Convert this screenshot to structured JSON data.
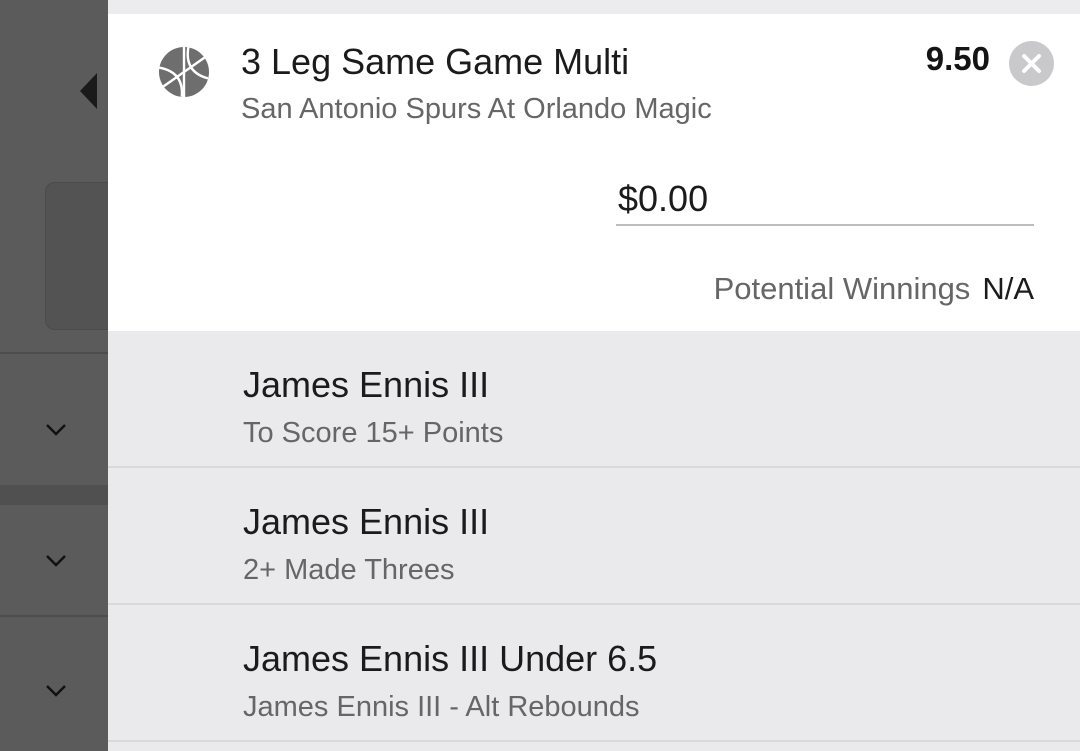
{
  "background": {
    "icons": [
      "chevron-left-icon",
      "chevron-down-icon"
    ]
  },
  "bet": {
    "sport_icon": "basketball-icon",
    "title": "3 Leg Same Game Multi",
    "event": "San Antonio Spurs At Orlando Magic",
    "odds": "9.50",
    "remove_icon": "close-icon",
    "stake_value": "$0.00",
    "potential_winnings_label": "Potential Winnings",
    "potential_winnings_value": "N/A"
  },
  "legs": [
    {
      "selection": "James Ennis III",
      "market": "To Score 15+ Points"
    },
    {
      "selection": "James Ennis III",
      "market": "2+ Made Threes"
    },
    {
      "selection": "James Ennis III Under 6.5",
      "market": "James Ennis III - Alt Rebounds"
    }
  ],
  "colors": {
    "overlay_bg": "#5b5b5b",
    "card_bg": "#ffffff",
    "leg_bg": "#eaeaec",
    "primary_text": "#1b1b1b",
    "secondary_text": "#666666",
    "close_button": "#c9c9cb"
  }
}
